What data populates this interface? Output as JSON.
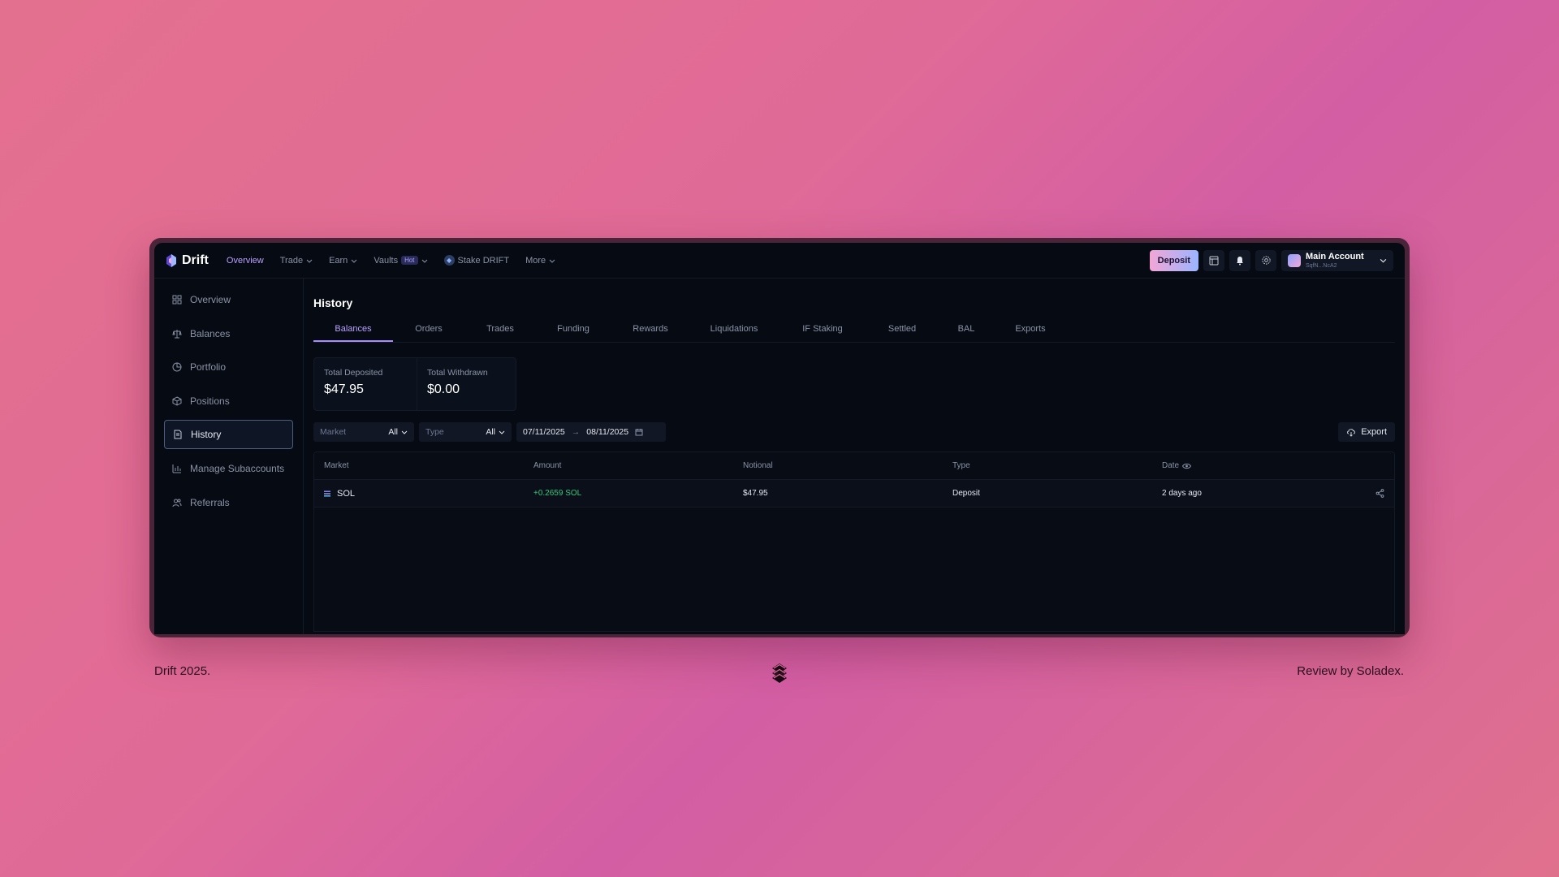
{
  "app": {
    "name": "Drift"
  },
  "nav": {
    "items": [
      {
        "label": "Overview",
        "active": true,
        "dropdown": false
      },
      {
        "label": "Trade",
        "active": false,
        "dropdown": true
      },
      {
        "label": "Earn",
        "active": false,
        "dropdown": true
      },
      {
        "label": "Vaults",
        "badge": "Hot",
        "active": false,
        "dropdown": true
      },
      {
        "label": "Stake DRIFT",
        "active": false,
        "dropdown": false
      },
      {
        "label": "More",
        "active": false,
        "dropdown": true
      }
    ],
    "deposit_label": "Deposit",
    "account": {
      "name": "Main Account",
      "address": "SqfN...NcA2"
    }
  },
  "sidebar": {
    "items": [
      {
        "label": "Overview",
        "icon": "grid-icon"
      },
      {
        "label": "Balances",
        "icon": "scale-icon"
      },
      {
        "label": "Portfolio",
        "icon": "pie-chart-icon"
      },
      {
        "label": "Positions",
        "icon": "cube-icon"
      },
      {
        "label": "History",
        "icon": "document-icon",
        "active": true
      },
      {
        "label": "Manage Subaccounts",
        "icon": "bar-chart-icon"
      },
      {
        "label": "Referrals",
        "icon": "users-icon"
      }
    ]
  },
  "page": {
    "title": "History",
    "tabs": [
      "Balances",
      "Orders",
      "Trades",
      "Funding",
      "Rewards",
      "Liquidations",
      "IF Staking",
      "Settled",
      "BAL",
      "Exports"
    ],
    "active_tab": "Balances",
    "stats": [
      {
        "label": "Total Deposited",
        "value": "$47.95"
      },
      {
        "label": "Total Withdrawn",
        "value": "$0.00"
      }
    ],
    "filters": {
      "market": {
        "label": "Market",
        "value": "All"
      },
      "type": {
        "label": "Type",
        "value": "All"
      },
      "date_from": "07/11/2025",
      "date_to": "08/11/2025"
    },
    "export_label": "Export",
    "table": {
      "columns": [
        "Market",
        "Amount",
        "Notional",
        "Type",
        "Date"
      ],
      "rows": [
        {
          "market": "SOL",
          "amount": "+0.2659 SOL",
          "notional": "$47.95",
          "type": "Deposit",
          "date": "2 days ago"
        }
      ]
    }
  },
  "footer": {
    "left": "Drift 2025.",
    "right": "Review by Soladex."
  },
  "colors": {
    "accent": "#b9a3ff",
    "positive": "#34c77b",
    "background": "#060a12"
  }
}
